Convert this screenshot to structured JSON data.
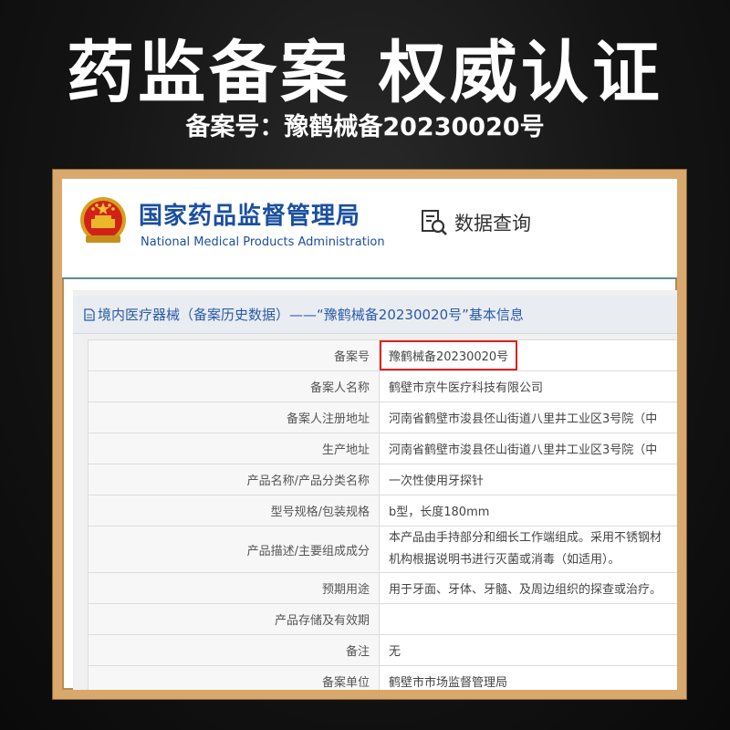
{
  "banner": {
    "headline": "药监备案 权威认证",
    "subline": "备案号：豫鹤械备20230020号"
  },
  "site": {
    "org_name_cn": "国家药品监督管理局",
    "org_name_en": "National Medical Products Administration",
    "query_label": "数据查询"
  },
  "panel": {
    "title": "境内医疗器械（备案历史数据）——“豫鹤械备20230020号”基本信息"
  },
  "rows": [
    {
      "label": "备案号",
      "value": "豫鹤械备20230020号"
    },
    {
      "label": "备案人名称",
      "value": "鹤壁市京牛医疗科技有限公司"
    },
    {
      "label": "备案人注册地址",
      "value": "河南省鹤壁市浚县伾山街道八里井工业区3号院（中"
    },
    {
      "label": "生产地址",
      "value": "河南省鹤壁市浚县伾山街道八里井工业区3号院（中"
    },
    {
      "label": "产品名称/产品分类名称",
      "value": "一次性使用牙探针"
    },
    {
      "label": "型号规格/包装规格",
      "value": "b型，长度180mm"
    },
    {
      "label": "产品描述/主要组成成分",
      "value_line1": "本产品由手持部分和细长工作端组成。采用不锈钢材",
      "value_line2": "机构根据说明书进行灭菌或消毒（如适用）。"
    },
    {
      "label": "预期用途",
      "value": "用于牙面、牙体、牙髓、及周边组织的探查或治疗。"
    },
    {
      "label": "产品存储及有效期",
      "value": ""
    },
    {
      "label": "备注",
      "value": "无"
    },
    {
      "label": "备案单位",
      "value": "鹤壁市市场监督管理局"
    }
  ]
}
